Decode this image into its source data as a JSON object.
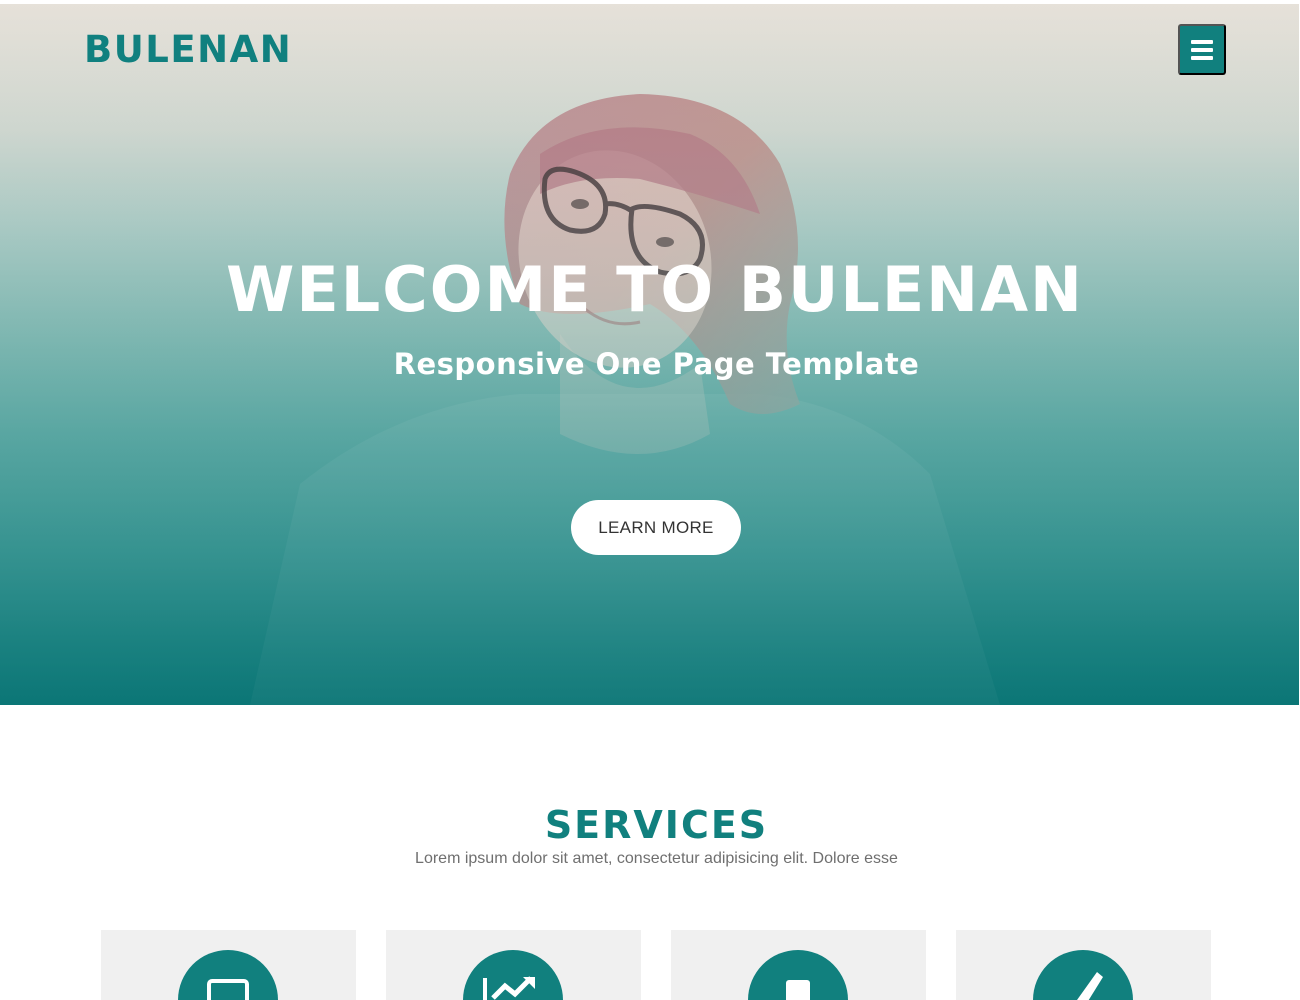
{
  "header": {
    "brand": "BULENAN",
    "menu_icon": "hamburger-menu-icon"
  },
  "hero": {
    "title": "WELCOME TO BULENAN",
    "subtitle": "Responsive One Page Template",
    "cta_label": "LEARN MORE",
    "background_image": "woman-with-glasses-photo"
  },
  "services": {
    "title": "SERVICES",
    "subtitle": "Lorem ipsum dolor sit amet, consectetur adipisicing elit. Dolore esse",
    "cards": [
      {
        "icon": "laptop-icon"
      },
      {
        "icon": "trending-chart-icon"
      },
      {
        "icon": "mobile-device-icon"
      },
      {
        "icon": "paintbrush-icon"
      }
    ]
  },
  "colors": {
    "accent": "#11807e",
    "hero_top": "#e6e1d9",
    "hero_bottom": "#0b7676",
    "card_background": "#f0f0f0",
    "text_muted": "#6f6f6f"
  }
}
